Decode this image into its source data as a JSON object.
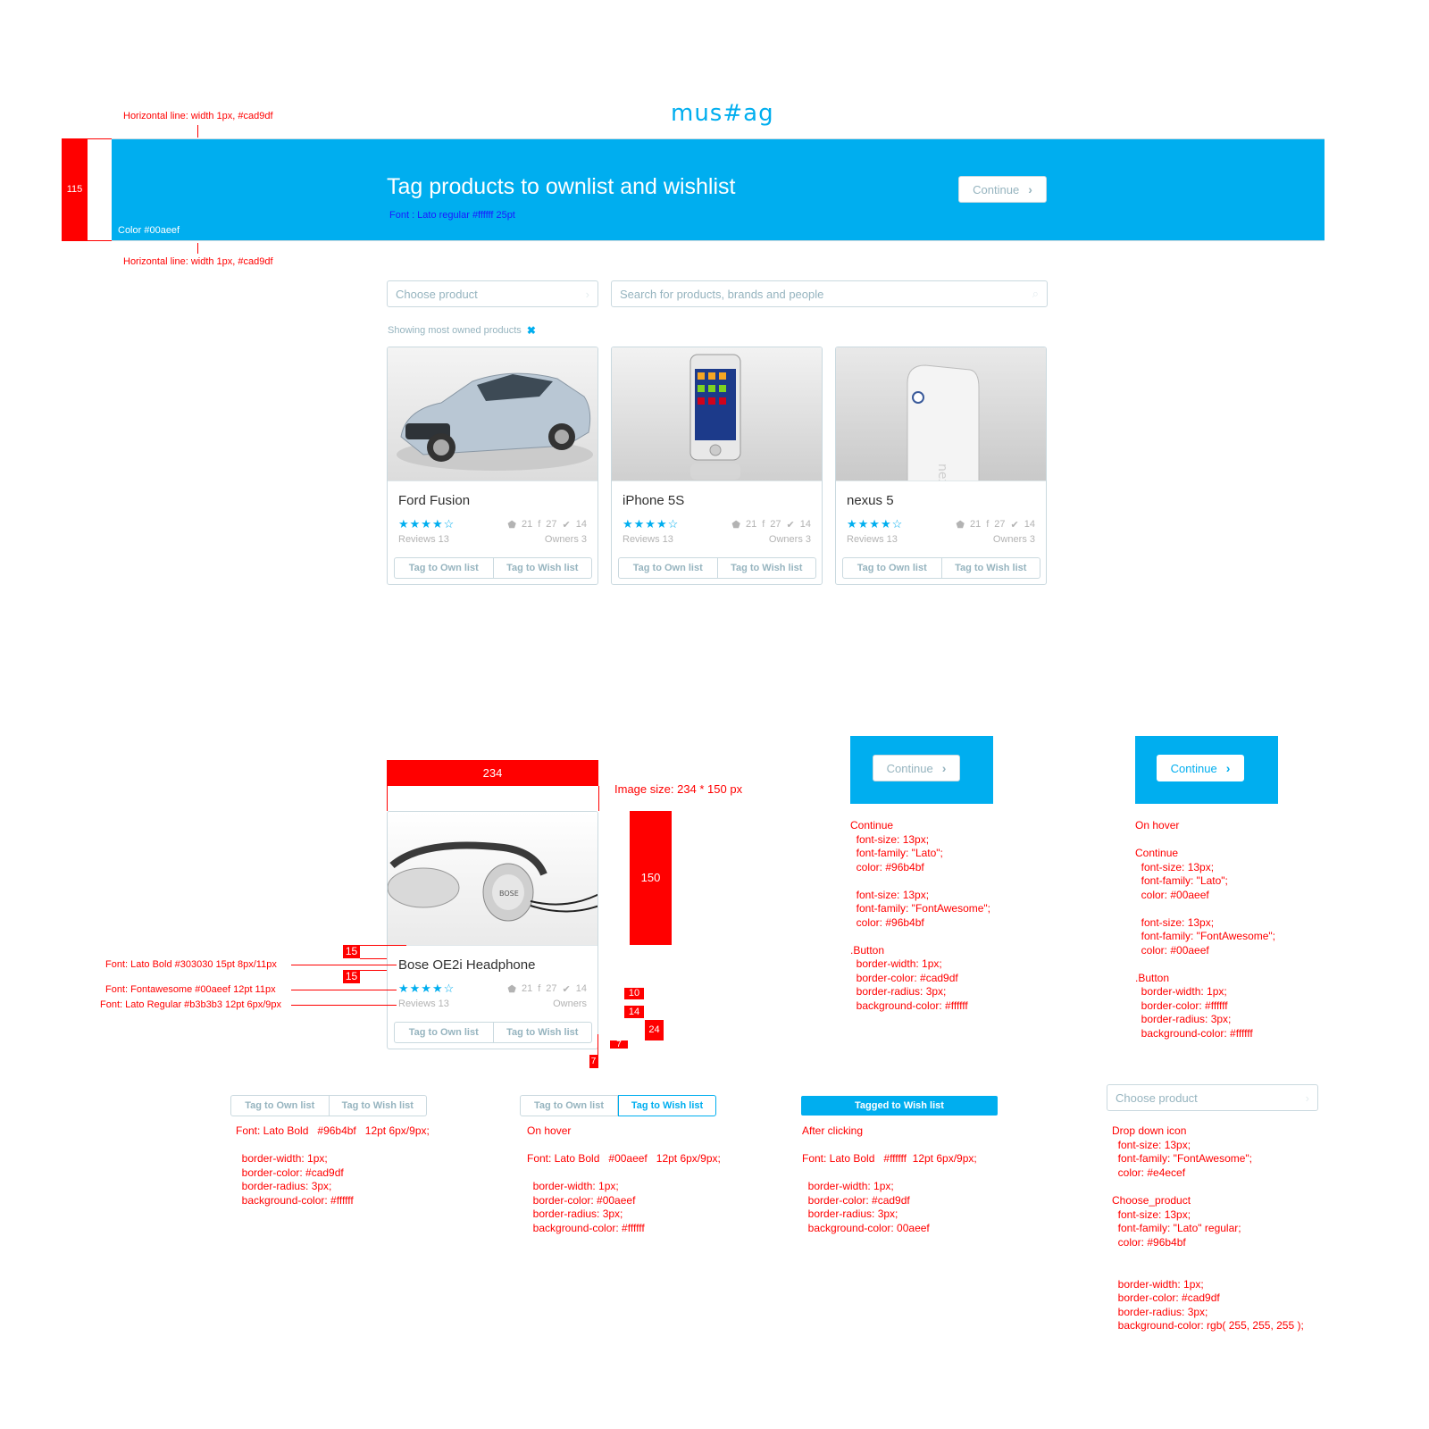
{
  "logo": "mus#ag",
  "banner": {
    "title": "Tag products to ownlist and wishlist",
    "font_note": "Font : Lato regular #ffffff  25pt",
    "color_note": "Color #00aeef",
    "continue_label": "Continue",
    "height_marker": "115",
    "line_note_top": "Horizontal line: width 1px, #cad9df",
    "line_note_bottom": "Horizontal line: width 1px, #cad9df",
    "color": "#00aeef"
  },
  "filters": {
    "choose_placeholder": "Choose product",
    "search_placeholder": "Search for products, brands and people",
    "showing": "Showing most owned products"
  },
  "products": [
    {
      "name": "Ford Fusion",
      "stars": "★★★★☆",
      "tags": "21",
      "fb": "27",
      "tw": "14",
      "reviews": "Reviews 13",
      "owners": "Owners 3",
      "own_btn": "Tag to Own list",
      "wish_btn": "Tag to Wish list"
    },
    {
      "name": "iPhone 5S",
      "stars": "★★★★☆",
      "tags": "21",
      "fb": "27",
      "tw": "14",
      "reviews": "Reviews 13",
      "owners": "Owners 3",
      "own_btn": "Tag to Own list",
      "wish_btn": "Tag to Wish list"
    },
    {
      "name": "nexus 5",
      "stars": "★★★★☆",
      "tags": "21",
      "fb": "27",
      "tw": "14",
      "reviews": "Reviews 13",
      "owners": "Owners 3",
      "own_btn": "Tag to Own list",
      "wish_btn": "Tag to Wish list"
    }
  ],
  "spec_card": {
    "name": "Bose OE2i Headphone",
    "stars": "★★★★☆",
    "tags": "21",
    "fb": "27",
    "tw": "14",
    "reviews": "Reviews 13",
    "owners": "Owners",
    "own_btn": "Tag to Own list",
    "wish_btn": "Tag to Wish list",
    "width_marker": "234",
    "height_marker": "150",
    "image_size_note": "Image size: 234 * 150 px",
    "font_name_note": "Font: Lato Bold  #303030 15pt  8px/11px",
    "font_stars_note": "Font: Fontawesome #00aeef 12pt  11px",
    "font_meta_note": "Font: Lato Regular #b3b3b3 12pt  6px/9px",
    "m15a": "15",
    "m15b": "15",
    "m10": "10",
    "m14": "14",
    "m24": "24",
    "m7a": "7",
    "m7b": "7"
  },
  "continue_spec": {
    "label": "Continue",
    "hover_label": "Continue",
    "note": "Continue\n  font-size: 13px;\n  font-family: \"Lato\";\n  color: #96b4bf\n\n  font-size: 13px;\n  font-family: \"FontAwesome\";\n  color: #96b4bf\n\n.Button\n  border-width: 1px;\n  border-color: #cad9df\n  border-radius: 3px;\n  background-color: #ffffff",
    "hover_note": "On hover\n\nContinue\n  font-size: 13px;\n  font-family: \"Lato\";\n  color: #00aeef\n\n  font-size: 13px;\n  font-family: \"FontAwesome\";\n  color: #00aeef\n\n.Button\n  border-width: 1px;\n  border-color: #ffffff\n  border-radius: 3px;\n  background-color: #ffffff"
  },
  "button_states": {
    "own": "Tag to Own list",
    "wish": "Tag to Wish list",
    "tagged": "Tagged to Wish list",
    "default_note": "Font: Lato Bold   #96b4bf   12pt 6px/9px;\n\n  border-width: 1px;\n  border-color: #cad9df\n  border-radius: 3px;\n  background-color: #ffffff",
    "hover_note": "On hover\n\nFont: Lato Bold   #00aeef   12pt 6px/9px;\n\n  border-width: 1px;\n  border-color: #00aeef\n  border-radius: 3px;\n  background-color: #ffffff",
    "clicked_note": "After clicking\n\nFont: Lato Bold   #ffffff  12pt 6px/9px;\n\n  border-width: 1px;\n  border-color: #cad9df\n  border-radius: 3px;\n  background-color: 00aeef"
  },
  "dropdown_spec": {
    "placeholder": "Choose product",
    "note": "Drop down icon\n  font-size: 13px;\n  font-family: \"FontAwesome\";\n  color: #e4ecef\n\nChoose_product\n  font-size: 13px;\n  font-family: \"Lato\" regular;\n  color: #96b4bf\n\n\n  border-width: 1px;\n  border-color: #cad9df\n  border-radius: 3px;\n  background-color: rgb( 255, 255, 255 );"
  }
}
